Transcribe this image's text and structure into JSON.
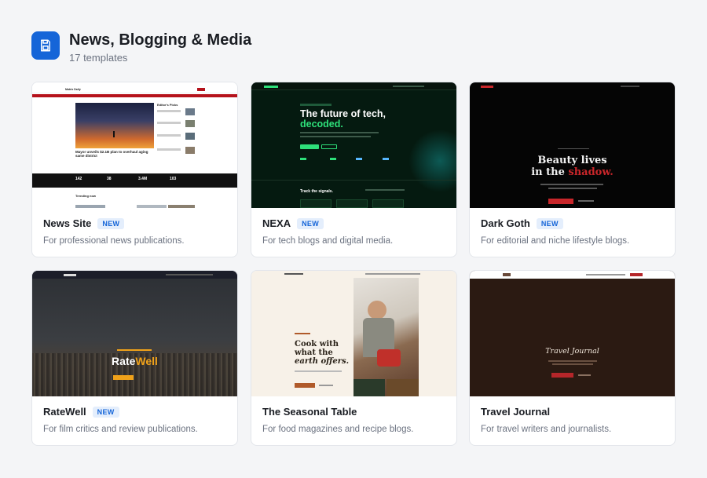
{
  "header": {
    "icon": "save-icon",
    "title": "News, Blogging & Media",
    "count": "17 templates"
  },
  "cards": [
    {
      "title": "News Site",
      "badge": "NEW",
      "description": "For professional news publications.",
      "preview": {
        "masthead": "Matrix Daily",
        "headline": "Mayor unveils $2.1B plan to overhaul aging same district",
        "sidebar_title": "Editor's Picks",
        "stats": [
          "142",
          "38",
          "3.4M",
          "103"
        ],
        "section": "Trending now"
      }
    },
    {
      "title": "NEXA",
      "badge": "NEW",
      "description": "For tech blogs and digital media.",
      "preview": {
        "hero_line1": "The future of tech,",
        "hero_line2": "decoded.",
        "section": "Track the signals."
      }
    },
    {
      "title": "Dark Goth",
      "badge": "NEW",
      "description": "For editorial and niche lifestyle blogs.",
      "preview": {
        "hero_line1": "Beauty lives",
        "hero_line2a": "in the ",
        "hero_line2b": "shadow."
      }
    },
    {
      "title": "RateWell",
      "badge": "NEW",
      "description": "For film critics and review publications.",
      "preview": {
        "logo_a": "Rate",
        "logo_b": "Well"
      }
    },
    {
      "title": "The Seasonal Table",
      "badge": "",
      "description": "For food magazines and recipe blogs.",
      "preview": {
        "hero_line1": "Cook with",
        "hero_line2": "what the",
        "hero_line3": "earth offers."
      }
    },
    {
      "title": "Travel Journal",
      "badge": "",
      "description": "For travel writers and journalists.",
      "preview": {
        "hero": "Travel Journal"
      }
    }
  ],
  "colors": {
    "accent": "#1565d8",
    "badge_bg": "#e4eefc",
    "nexa_green": "#2ee07a",
    "goth_red": "#c8262a",
    "ratewell_gold": "#f0a21a",
    "news_red": "#b5121b"
  }
}
